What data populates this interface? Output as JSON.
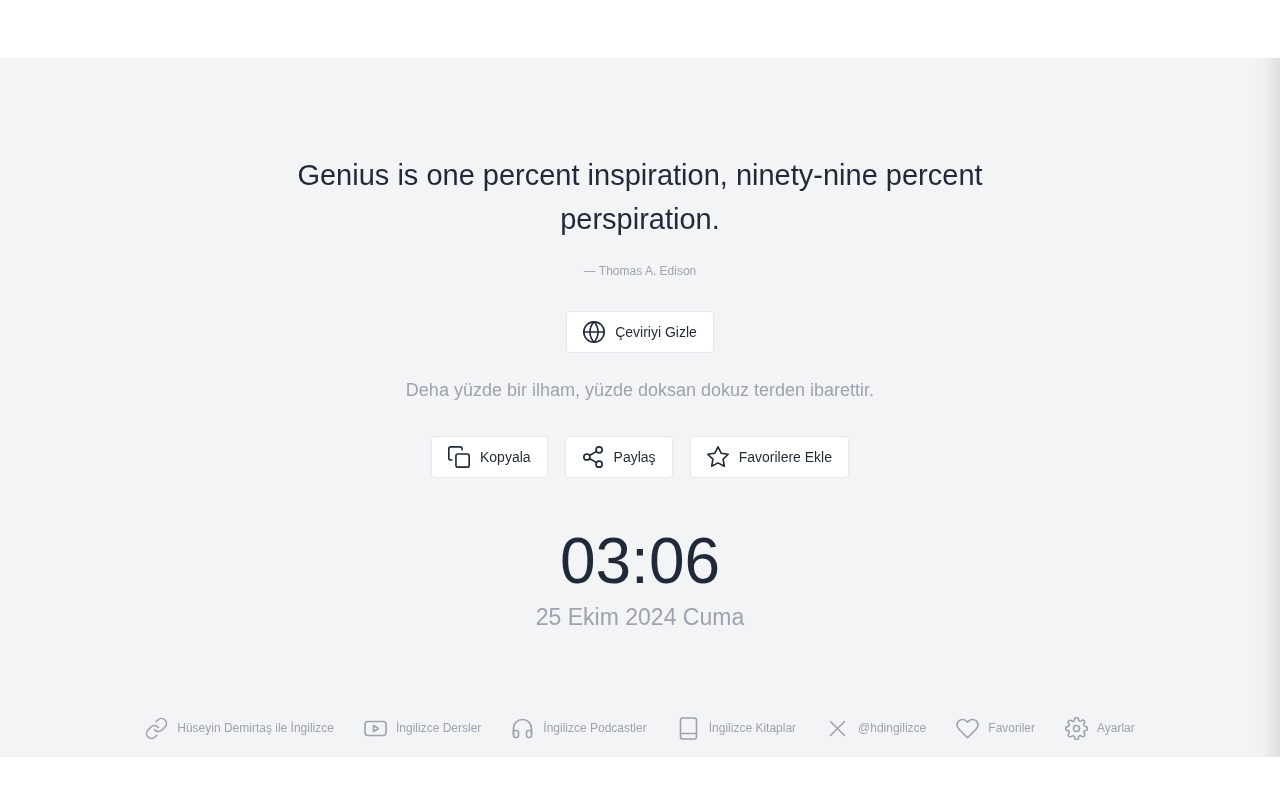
{
  "quote": {
    "text": "Genius is one percent inspiration, ninety-nine percent perspiration.",
    "author": "— Thomas A. Edison"
  },
  "translation_toggle": {
    "kind": "translate",
    "label": "Çeviriyi Gizle"
  },
  "translation": {
    "text": "Deha yüzde bir ilham, yüzde doksan dokuz terden ibarettir."
  },
  "actions": [
    {
      "kind": "copy",
      "label": "Kopyala"
    },
    {
      "kind": "share",
      "label": "Paylaş"
    },
    {
      "kind": "favorite",
      "label": "Favorilere Ekle"
    }
  ],
  "clock": {
    "time": "03:06",
    "date": "25 Ekim 2024 Cuma"
  },
  "footer_links": [
    {
      "kind": "link",
      "label": "Hüseyin Demirtaş ile İngilizce"
    },
    {
      "kind": "video",
      "label": "İngilizce Dersler"
    },
    {
      "kind": "podcast",
      "label": "İngilizce Podcastler"
    },
    {
      "kind": "book",
      "label": "İngilizce Kitaplar"
    },
    {
      "kind": "x",
      "label": "@hdingilizce"
    },
    {
      "kind": "favorites",
      "label": "Favoriler"
    },
    {
      "kind": "settings",
      "label": "Ayarlar"
    }
  ]
}
